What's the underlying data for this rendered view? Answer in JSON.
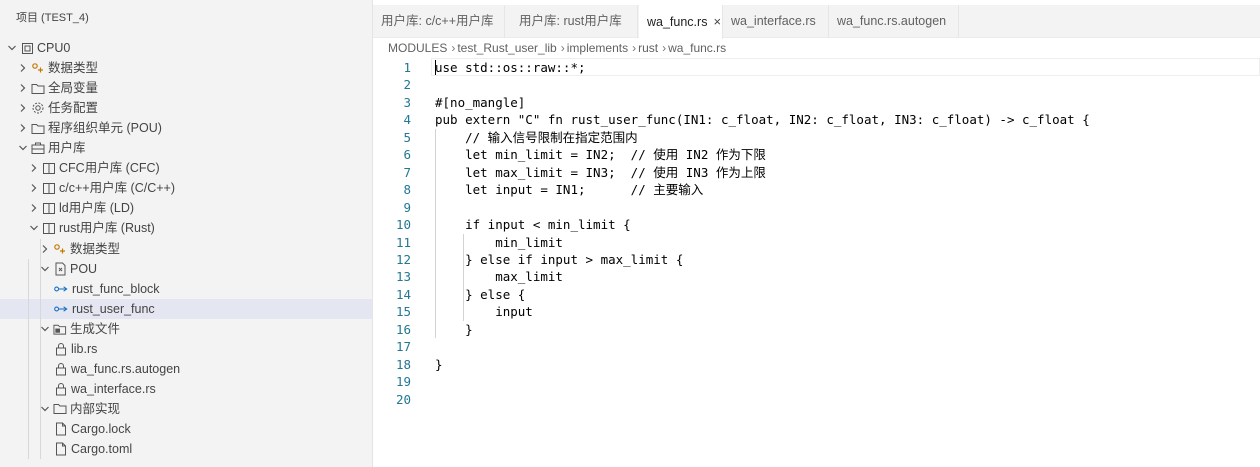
{
  "sidebar": {
    "title": "项目 (TEST_4)",
    "tree": [
      {
        "label": "CPU0",
        "depth": 0,
        "chevron": "down",
        "icon": "device-icon"
      },
      {
        "label": "数据类型",
        "depth": 1,
        "chevron": "right",
        "icon": "datatype-icon"
      },
      {
        "label": "全局变量",
        "depth": 1,
        "chevron": "right",
        "icon": "folder-icon"
      },
      {
        "label": "任务配置",
        "depth": 1,
        "chevron": "right",
        "icon": "gear-icon"
      },
      {
        "label": "程序组织单元 (POU)",
        "depth": 1,
        "chevron": "right",
        "icon": "folder-icon"
      },
      {
        "label": "用户库",
        "depth": 1,
        "chevron": "down",
        "icon": "library-icon"
      },
      {
        "label": "CFC用户库 (CFC)",
        "depth": 2,
        "chevron": "right",
        "icon": "book-icon"
      },
      {
        "label": "c/c++用户库 (C/C++)",
        "depth": 2,
        "chevron": "right",
        "icon": "book-icon"
      },
      {
        "label": "ld用户库 (LD)",
        "depth": 2,
        "chevron": "right",
        "icon": "book-icon"
      },
      {
        "label": "rust用户库 (Rust)",
        "depth": 2,
        "chevron": "down",
        "icon": "book-icon"
      },
      {
        "label": "数据类型",
        "depth": 3,
        "chevron": "right",
        "icon": "datatype-icon"
      },
      {
        "label": "POU",
        "depth": 3,
        "chevron": "down",
        "icon": "pou-file-icon"
      },
      {
        "label": "rust_func_block",
        "depth": 4,
        "chevron": "",
        "icon": "link-icon"
      },
      {
        "label": "rust_user_func",
        "depth": 4,
        "chevron": "",
        "icon": "link-icon",
        "selected": true
      },
      {
        "label": "生成文件",
        "depth": 3,
        "chevron": "down",
        "icon": "generated-folder-icon"
      },
      {
        "label": "lib.rs",
        "depth": 4,
        "chevron": "",
        "icon": "lock-icon"
      },
      {
        "label": "wa_func.rs.autogen",
        "depth": 4,
        "chevron": "",
        "icon": "lock-icon"
      },
      {
        "label": "wa_interface.rs",
        "depth": 4,
        "chevron": "",
        "icon": "lock-icon"
      },
      {
        "label": "内部实现",
        "depth": 3,
        "chevron": "down",
        "icon": "folder-icon"
      },
      {
        "label": "Cargo.lock",
        "depth": 4,
        "chevron": "",
        "icon": "file-icon"
      },
      {
        "label": "Cargo.toml",
        "depth": 4,
        "chevron": "",
        "icon": "file-icon"
      }
    ]
  },
  "tabs": [
    {
      "label": "用户库: c/c++用户库",
      "active": false
    },
    {
      "label": "用户库: rust用户库",
      "active": false
    },
    {
      "label": "wa_func.rs",
      "active": true,
      "close": "×"
    },
    {
      "label": "wa_interface.rs",
      "active": false
    },
    {
      "label": "wa_func.rs.autogen",
      "active": false
    }
  ],
  "breadcrumb": [
    "MODULES",
    "test_Rust_user_lib",
    "implements",
    "rust",
    "wa_func.rs"
  ],
  "editor": {
    "lines": [
      "use std::os::raw::*;",
      "",
      "#[no_mangle]",
      "pub extern \"C\" fn rust_user_func(IN1: c_float, IN2: c_float, IN3: c_float) -> c_float {",
      "    // 输入信号限制在指定范围内",
      "    let min_limit = IN2;  // 使用 IN2 作为下限",
      "    let max_limit = IN3;  // 使用 IN3 作为上限",
      "    let input = IN1;      // 主要输入",
      "",
      "    if input < min_limit {",
      "        min_limit",
      "    } else if input > max_limit {",
      "        max_limit",
      "    } else {",
      "        input",
      "    }",
      "",
      "}",
      "",
      ""
    ]
  }
}
